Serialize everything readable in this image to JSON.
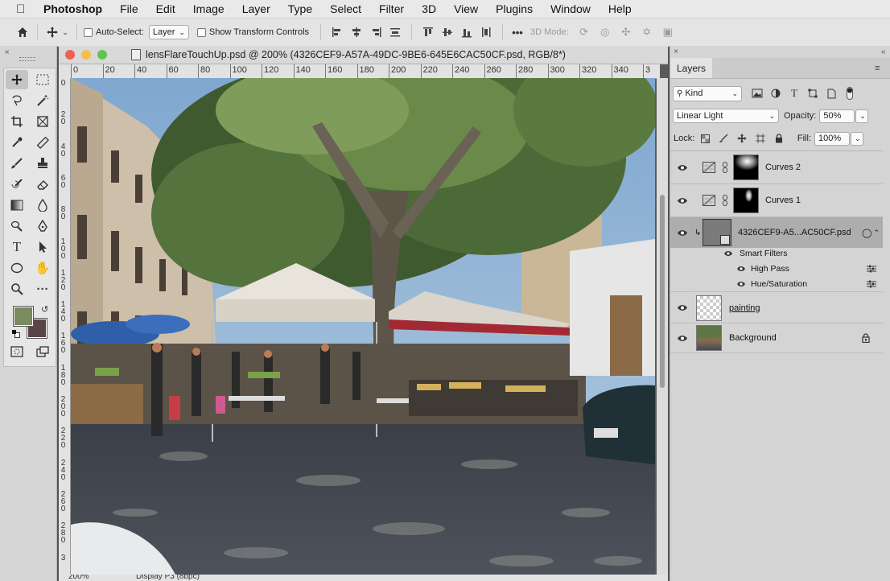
{
  "menubar": {
    "app_name": "Photoshop",
    "items": [
      "File",
      "Edit",
      "Image",
      "Layer",
      "Type",
      "Select",
      "Filter",
      "3D",
      "View",
      "Plugins",
      "Window",
      "Help"
    ]
  },
  "options_bar": {
    "auto_select_label": "Auto-Select:",
    "auto_select_value": "Layer",
    "show_transform_label": "Show Transform Controls",
    "three_d_mode_label": "3D Mode:",
    "more_label": "•••"
  },
  "document": {
    "title": "lensFlareTouchUp.psd @ 200% (4326CEF9-A57A-49DC-9BE6-645E6CAC50CF.psd, RGB/8*)",
    "ruler_top": [
      "0",
      "20",
      "40",
      "60",
      "80",
      "100",
      "120",
      "140",
      "160",
      "180",
      "200",
      "220",
      "240",
      "260",
      "280",
      "300",
      "320",
      "340",
      "3"
    ],
    "ruler_left": [
      "0",
      "2 0",
      "4 0",
      "6 0",
      "8 0",
      "1 0 0",
      "1 2 0",
      "1 4 0",
      "1 6 0",
      "1 8 0",
      "2 0 0",
      "2 2 0",
      "2 4 0",
      "2 6 0",
      "2 8 0",
      "3"
    ],
    "status_zoom": "200%",
    "status_info": "Display P3 (8bpc)"
  },
  "layers_panel": {
    "tab_label": "Layers",
    "filter_kind": "Kind",
    "blend_mode": "Linear Light",
    "opacity_label": "Opacity:",
    "opacity_value": "50%",
    "lock_label": "Lock:",
    "fill_label": "Fill:",
    "fill_value": "100%",
    "layers": [
      {
        "name": "Curves 2",
        "type": "adjustment",
        "visible": true
      },
      {
        "name": "Curves 1",
        "type": "adjustment",
        "visible": true
      },
      {
        "name": "4326CEF9-A5...AC50CF.psd",
        "type": "smart-object",
        "visible": true,
        "selected": true,
        "smart_filters_label": "Smart Filters",
        "filters": [
          "High Pass",
          "Hue/Saturation"
        ]
      },
      {
        "name": "painting",
        "type": "pixel",
        "visible": true
      },
      {
        "name": "Background",
        "type": "background",
        "visible": true,
        "locked": true
      }
    ]
  },
  "colors": {
    "foreground": "#7b8a5f",
    "background": "#5a4546",
    "selected_layer": "#adadad"
  }
}
